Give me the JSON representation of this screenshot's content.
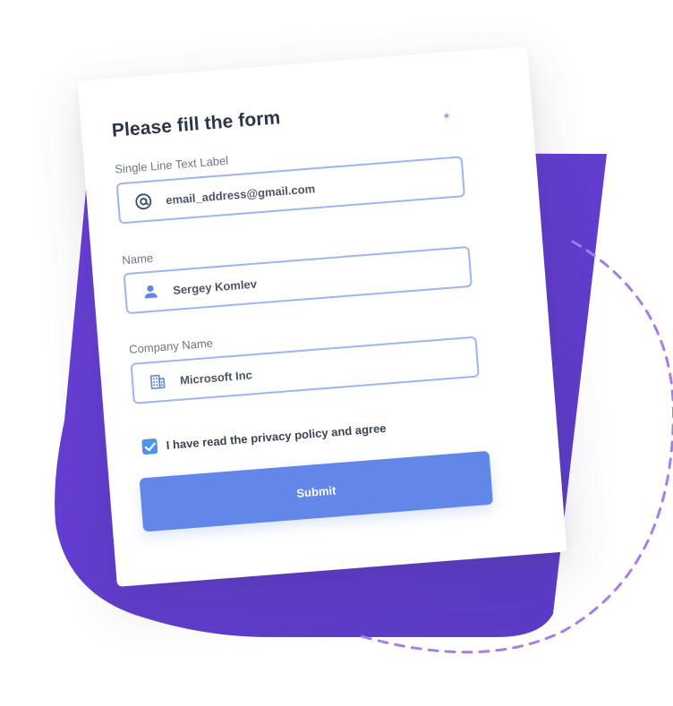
{
  "colors": {
    "purple_gradient_start": "#6a3fd8",
    "purple_gradient_end": "#5a3bc4",
    "dashed_circle": "#a77ee6",
    "field_border": "#9fb4f0",
    "accent_blue": "#6287e8",
    "checkbox_blue": "#4f95e6",
    "title_text": "#2c3649"
  },
  "form": {
    "title": "Please fill the form",
    "required_marker": "*",
    "fields": [
      {
        "label": "Single Line Text Label",
        "value": "email_address@gmail.com",
        "icon": "at-sign-icon"
      },
      {
        "label": "Name",
        "value": "Sergey Komlev",
        "icon": "user-icon"
      },
      {
        "label": "Company Name",
        "value": "Microsoft Inc",
        "icon": "building-icon"
      }
    ],
    "privacy_checkbox": {
      "checked": true,
      "label": "I have read the privacy policy and agree"
    },
    "submit_label": "Submit"
  }
}
